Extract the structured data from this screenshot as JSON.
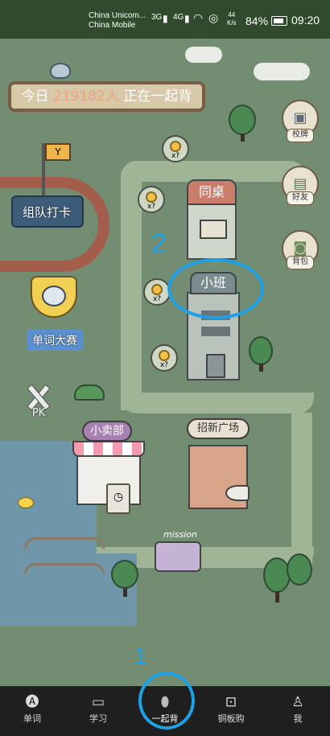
{
  "status_bar": {
    "carrier_1": "China Unicom...",
    "carrier_2": "China Mobile",
    "net_1": "3G",
    "net_2": "4G",
    "speed_value": "44",
    "speed_unit": "K/s",
    "battery": "84%",
    "time": "09:20"
  },
  "banner": {
    "prefix": "今日",
    "count": "219182人",
    "suffix": "正在一起背"
  },
  "map": {
    "team_checkin": "组队打卡",
    "word_contest": "单词大赛",
    "pk": "PK",
    "shop": "小卖部",
    "recruit_square": "招新广场",
    "deskmate": "同桌",
    "small_class": "小班",
    "mission": "mission",
    "coin_label": "x?"
  },
  "side_buttons": [
    {
      "label": "校牌",
      "icon": "badge-icon"
    },
    {
      "label": "好友",
      "icon": "friends-icon"
    },
    {
      "label": "背包",
      "icon": "backpack-icon"
    }
  ],
  "tabbar": [
    {
      "label": "单词",
      "icon": "word-book-icon"
    },
    {
      "label": "学习",
      "icon": "study-screen-icon"
    },
    {
      "label": "一起背",
      "icon": "planet-icon"
    },
    {
      "label": "铜板购",
      "icon": "coin-shop-icon"
    },
    {
      "label": "我",
      "icon": "person-icon"
    }
  ],
  "annotations": {
    "marker_1": "1",
    "marker_2": "2"
  },
  "colors": {
    "map_green": "#728d72",
    "status_bar": "#2f4a2c",
    "tabbar": "#1f1f1f",
    "annotation_blue": "#1ea0e6",
    "banner_number": "#f2a37a"
  }
}
